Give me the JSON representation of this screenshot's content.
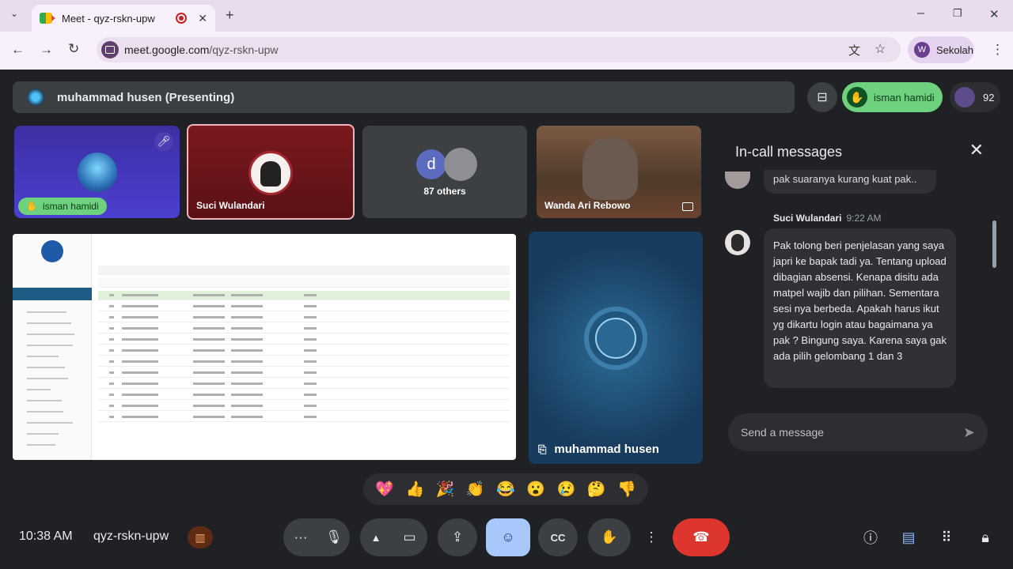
{
  "browser": {
    "tab_title": "Meet - qyz-rskn-upw",
    "url_domain": "meet.google.com",
    "url_path": "/qyz-rskn-upw",
    "profile_initial": "W",
    "profile_name": "Sekolah"
  },
  "presenter_bar": {
    "label": "muhammad husen (Presenting)"
  },
  "top_right": {
    "raised_hand_name": "isman hamidi",
    "participant_count": "92"
  },
  "tiles": {
    "tile1_name": "isman hamidi",
    "tile2_name": "Suci Wulandari",
    "tile3_initial": "d",
    "tile3_label": "87 others",
    "tile4_name": "Wanda Ari Rebowo",
    "presenter_name": "muhammad husen"
  },
  "chat": {
    "title": "In-call messages",
    "prev_message": "pak suaranya kurang kuat pak..",
    "sender": "Suci Wulandari",
    "time": "9:22 AM",
    "message": "Pak tolong beri penjelasan yang saya japri ke bapak tadi ya. Tentang upload dibagian absensi. Kenapa disitu ada matpel wajib dan pilihan. Sementara sesi nya berbeda. Apakah harus ikut yg dikartu login atau bagaimana ya pak ? Bingung saya. Karena saya gak ada pilih gelombang 1 dan 3",
    "input_placeholder": "Send a message"
  },
  "reactions": [
    "💖",
    "👍",
    "🎉",
    "👏",
    "😂",
    "😮",
    "😢",
    "🤔",
    "👎"
  ],
  "bottom": {
    "clock": "10:38 AM",
    "meeting_code": "qyz-rskn-upw"
  },
  "colors": {
    "background": "#202124",
    "raised_hand": "#6ed17d",
    "leave": "#dc362e",
    "active_button": "#a8c7fa"
  }
}
